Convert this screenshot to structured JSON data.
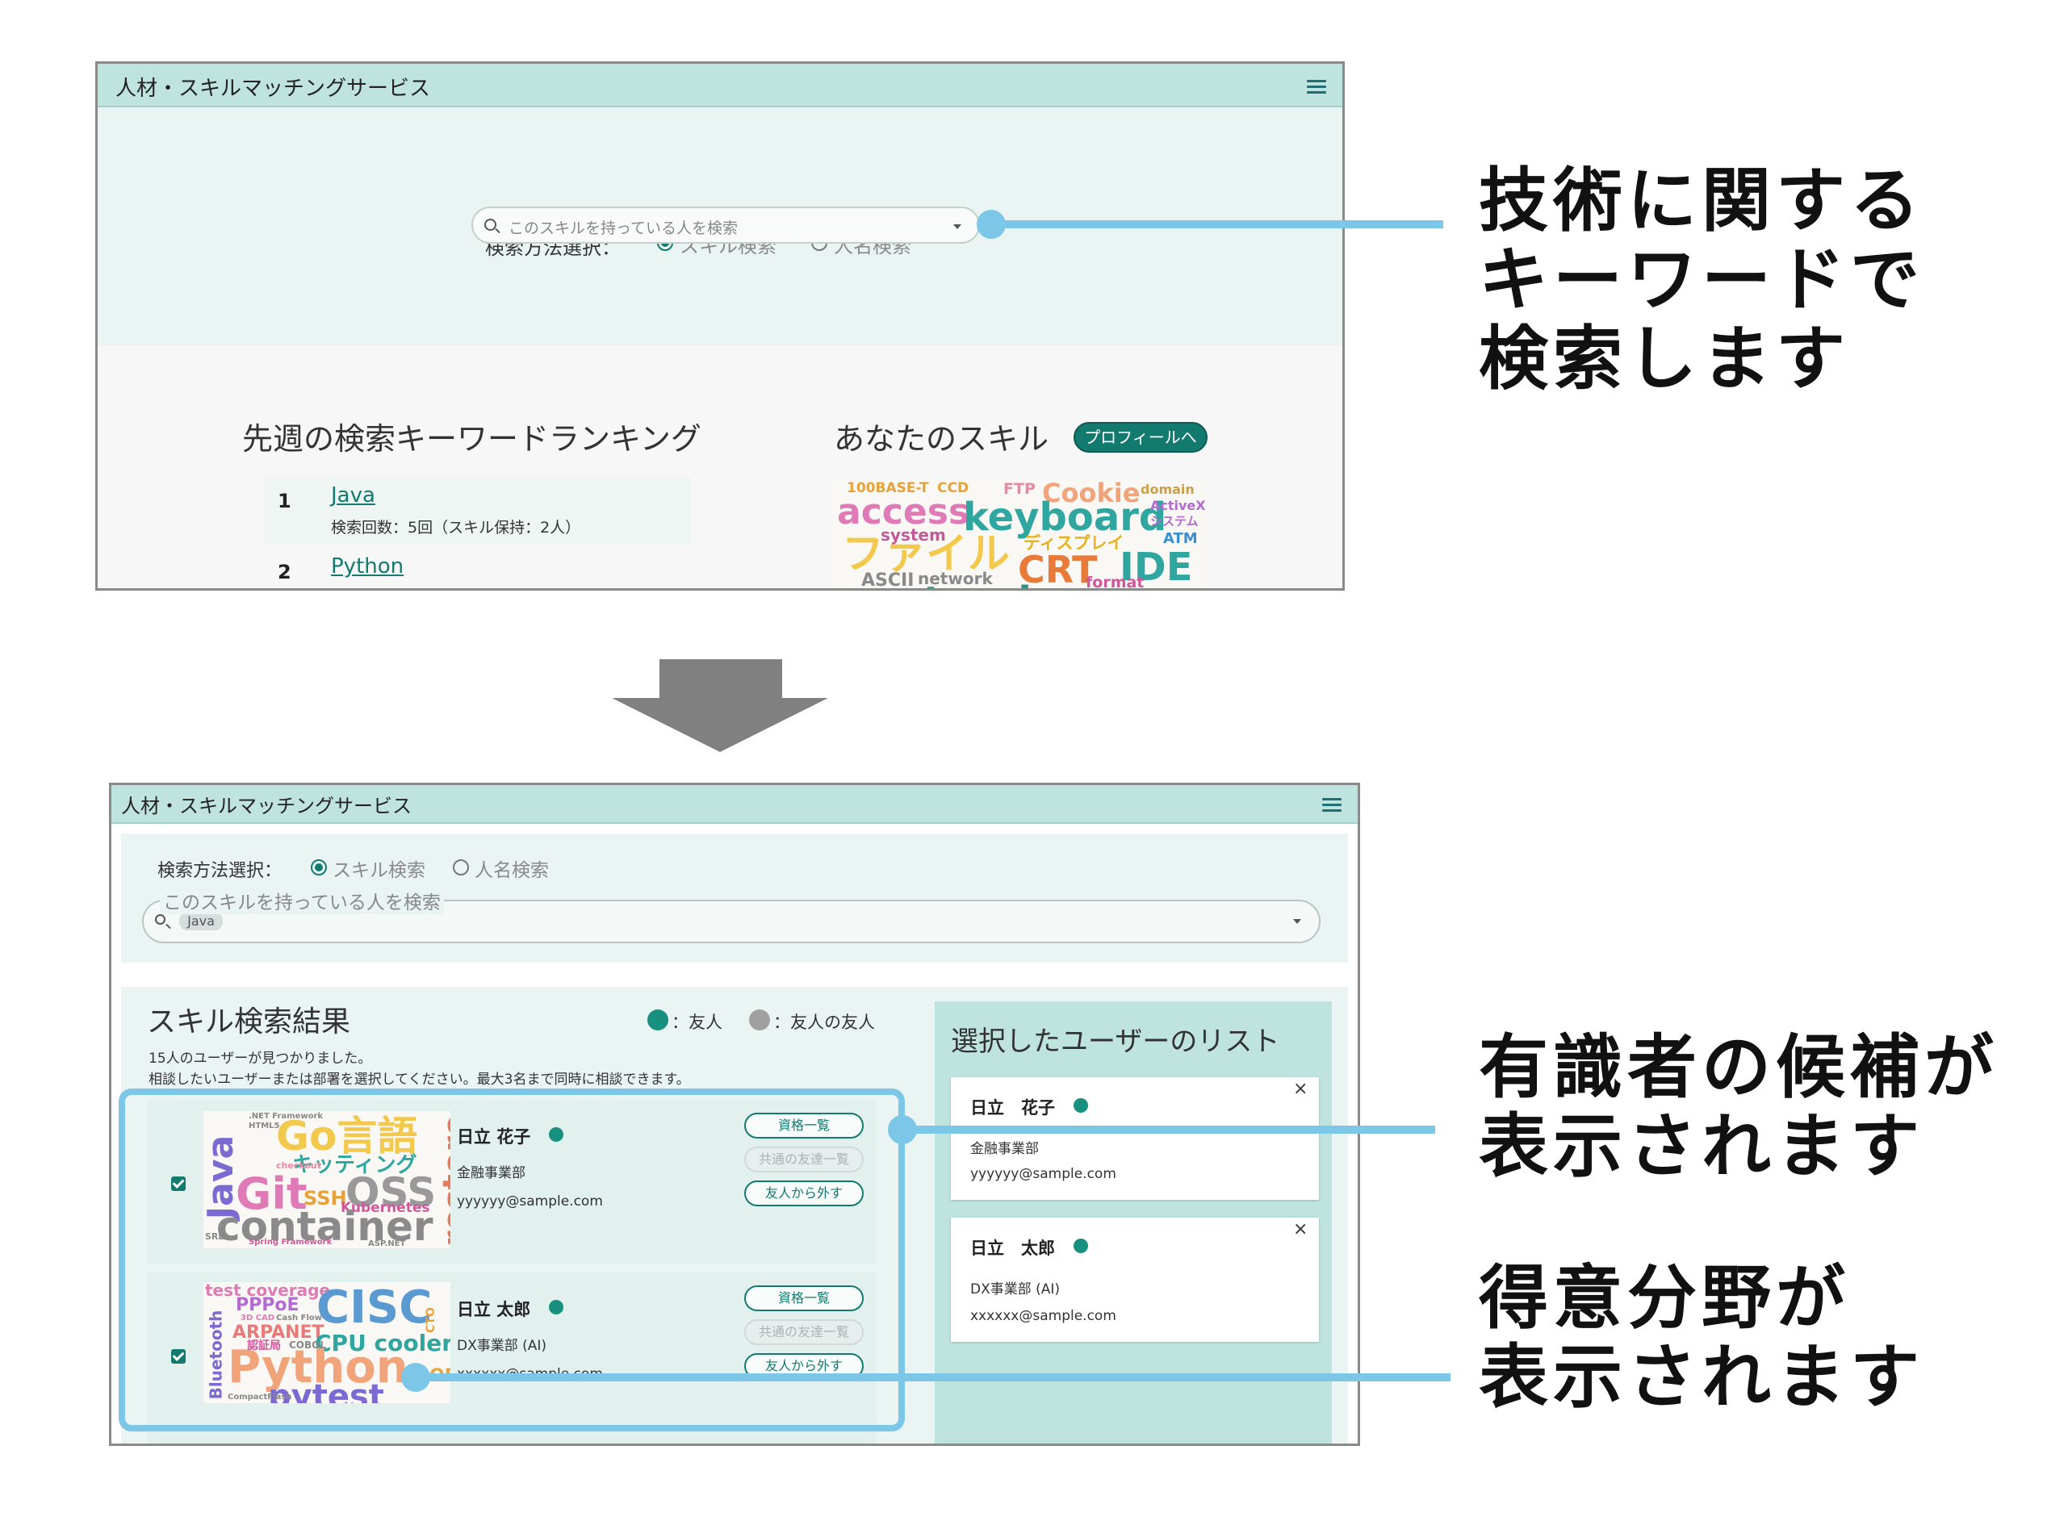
{
  "app": {
    "title": "人材・スキルマッチングサービス"
  },
  "search": {
    "method_label": "検索方法選択：",
    "options": [
      "スキル検索",
      "人名検索"
    ],
    "selected": "スキル検索",
    "placeholder": "このスキルを持っている人を検索",
    "tag": "Java"
  },
  "ranking": {
    "title": "先週の検索キーワードランキング",
    "items": [
      {
        "rank": "1",
        "keyword": "Java",
        "detail": "検索回数：5回（スキル保持：2人）"
      },
      {
        "rank": "2",
        "keyword": "Python"
      }
    ]
  },
  "your_skills": {
    "title": "あなたのスキル",
    "profile_button": "プロフィールへ",
    "cloud": [
      "100BASE-T",
      "CCD",
      "FTP",
      "Cookie",
      "domain",
      "access",
      "keyboard",
      "ActiveX",
      "システム",
      "system",
      "ディスプレイ",
      "ATM",
      "ファイル",
      "CRT",
      "IDE",
      "ASCII",
      "network",
      "format",
      "protocol"
    ]
  },
  "results": {
    "title": "スキル検索結果",
    "legend_friend": "：友人",
    "legend_fof": "：友人の友人",
    "count_text": "15人のユーザーが見つかりました。",
    "hint_text": "相談したいユーザーまたは部署を選択してください。最大3名まで同時に相談できます。",
    "buttons": {
      "qualifications": "資格一覧",
      "mutual_friends": "共通の友達一覧",
      "unfriend": "友人から外す"
    },
    "users": [
      {
        "name": "日立 花子",
        "dept": "金融事業部",
        "email": "yyyyyy@sample.com",
        "cloud": [
          "Go言語",
          "Java",
          "キッティング",
          "restore",
          "Git",
          "SSH",
          "OSS",
          "Kubernetes",
          "container",
          "Spring Framework",
          "checkout",
          "SRE",
          "ASP.NET",
          ".NET Framework",
          "HTML5"
        ]
      },
      {
        "name": "日立 太郎",
        "dept": "DX事業部 (AI)",
        "email": "xxxxxx@sample.com",
        "cloud": [
          "test coverage",
          "CISC",
          "PPPoE",
          "ARPANET",
          "CPU cooler",
          "Python",
          "pytest",
          "Bluetooth",
          "BLOB",
          "認証局",
          "COBOL",
          "3D CAD",
          "Cash Flow",
          "CompactFlash",
          "CTO"
        ]
      }
    ]
  },
  "selected_list": {
    "title": "選択したユーザーのリスト",
    "users": [
      {
        "name": "日立　花子",
        "dept": "金融事業部",
        "email": "yyyyyy@sample.com"
      },
      {
        "name": "日立　太郎",
        "dept": "DX事業部 (AI)",
        "email": "xxxxxx@sample.com"
      }
    ],
    "close_symbol": "×"
  },
  "annotations": {
    "a1": [
      "技術に関する",
      "キーワードで",
      "検索します"
    ],
    "a2": [
      "有識者の候補が",
      "表示されます"
    ],
    "a3": [
      "得意分野が",
      "表示されます"
    ]
  },
  "colors": {
    "accent": "#137a70",
    "appbar": "#bfe3df",
    "panel": "#eaf4f2",
    "annotation": "#7cc6e8",
    "friend_dot": "#17907f",
    "fof_dot": "#a0a0a0"
  }
}
